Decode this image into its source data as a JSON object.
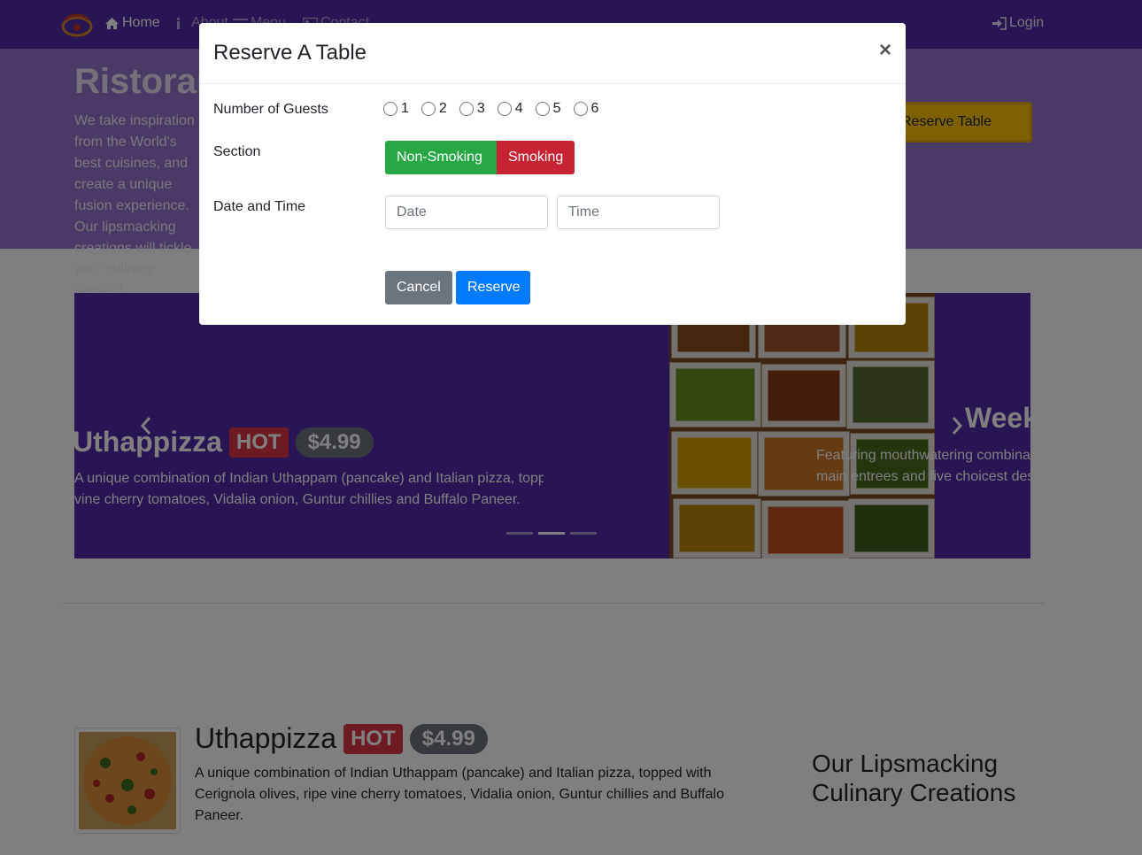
{
  "navbar": {
    "home": "Home",
    "about": "About",
    "menu": "Menu",
    "contact": "Contact",
    "login": "Login"
  },
  "jumbotron": {
    "title": "Ristorante con Fusion",
    "text": "We take inspiration from the World's best cuisines, and create a unique fusion experience. Our lipsmacking creations will tickle your culinary senses!",
    "reserve_button": "Reserve Table"
  },
  "carousel": {
    "slide1": {
      "title": "Uthappizza",
      "badge": "HOT",
      "price": "$4.99",
      "text_line1": "A unique combination of Indian Uthappam (pancake) and Italian pizza, topped with Cerignola olives, ripe",
      "text_line2": "vine cherry tomatoes, Vidalia onion, Guntur chillies and Buffalo Paneer."
    },
    "slide2": {
      "title": "Weekend Grand Buffet",
      "text_line1": "Featuring mouthwatering combinations with a choice of five different salads, six enticing appetizers, six",
      "text_line2": "main entrees and five choicest desserts."
    },
    "indicator_count": 3,
    "active_indicator": 1
  },
  "media": {
    "title": "Uthappizza",
    "badge": "HOT",
    "price": "$4.99",
    "text": "A unique combination of Indian Uthappam (pancake) and Italian pizza, topped with Cerignola olives, ripe vine cherry tomatoes, Vidalia onion, Guntur chillies and Buffalo Paneer."
  },
  "side_heading": "Our Lipsmacking Culinary Creations",
  "modal": {
    "title": "Reserve A Table",
    "close": "×",
    "guests_label": "Number of Guests",
    "guest_options": [
      "1",
      "2",
      "3",
      "4",
      "5",
      "6"
    ],
    "section_label": "Section",
    "section_non_smoking": "Non-Smoking",
    "section_smoking": "Smoking",
    "datetime_label": "Date and Time",
    "date_placeholder": "Date",
    "time_placeholder": "Time",
    "cancel": "Cancel",
    "reserve": "Reserve"
  },
  "colors": {
    "primary": "#512DA8",
    "light_primary": "#9575CD",
    "warning": "#FFC107",
    "success": "#28a745",
    "danger": "#c82333",
    "info": "#007bff",
    "secondary": "#6c757d"
  }
}
